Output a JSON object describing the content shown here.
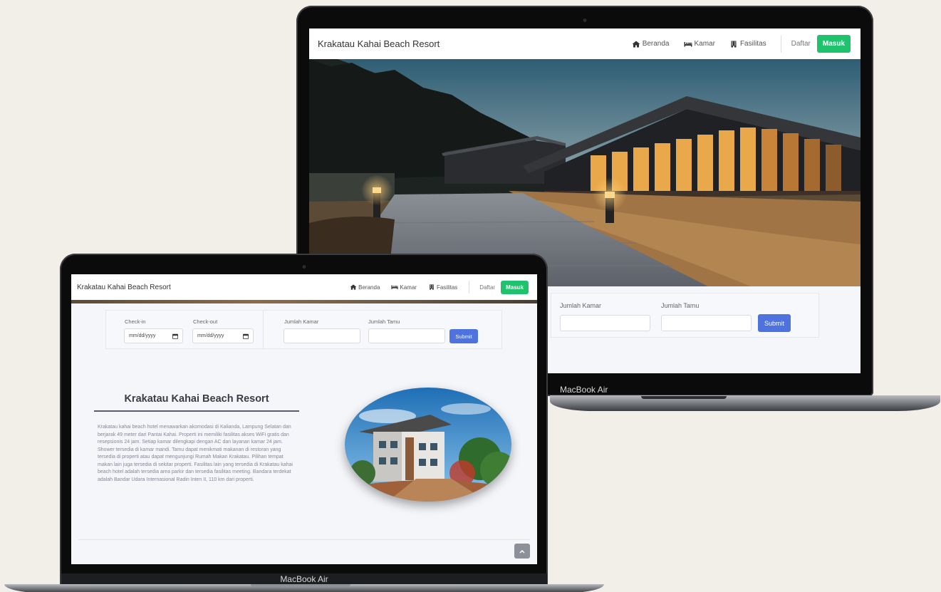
{
  "site": {
    "brand": "Krakatau Kahai Beach Resort",
    "nav": {
      "home_label": "Beranda",
      "rooms_label": "Kamar",
      "facilities_label": "Fasilitas",
      "register_label": "Daftar",
      "login_label": "Masuk"
    }
  },
  "booking": {
    "checkin_label": "Check-in",
    "checkout_label": "Check-out",
    "date_placeholder": "mm/dd/yyyy",
    "rooms_label": "Jumlah Kamar",
    "guests_label": "Jumlah Tamu",
    "submit_label": "Submit"
  },
  "about": {
    "title": "Krakatau Kahai Beach Resort",
    "description": "Krakatau kahai beach hotel menawarkan akomodasi di Kalianda, Lampung Selatan dan berjarak 49 meter dari Pantai Kahai. Properti ini memiliki fasilitas akses WiFi gratis dan resepsionis 24 jam. Setiap kamar dilengkapi dengan AC dan layanan kamar 24 jam. Shower tersedia di kamar mandi. Tamu dapat menikmati makanan di restoran yang tersedia di properti atau dapat mengunjungi Rumah Makan Krakatau. Pilihan tempat makan lain juga tersedia di sekitar properti. Fasilitas lain yang tersedia di Krakatau kahai beach hotel adalah tersedia area parkir dan tersedia fasilitas meeting. Bandara terdekat adalah Bandar Udara Internasional Radin Inten II, 110 km dari properti."
  },
  "device": {
    "label": "MacBook Air"
  },
  "icons": {
    "home": "home-icon",
    "rooms": "bed-icon",
    "facilities": "building-icon",
    "calendar": "calendar-icon",
    "scroll_top": "chevron-up-icon"
  },
  "colors": {
    "primary": "#4e73df",
    "success": "#20c26e",
    "background": "#f2efe8"
  }
}
